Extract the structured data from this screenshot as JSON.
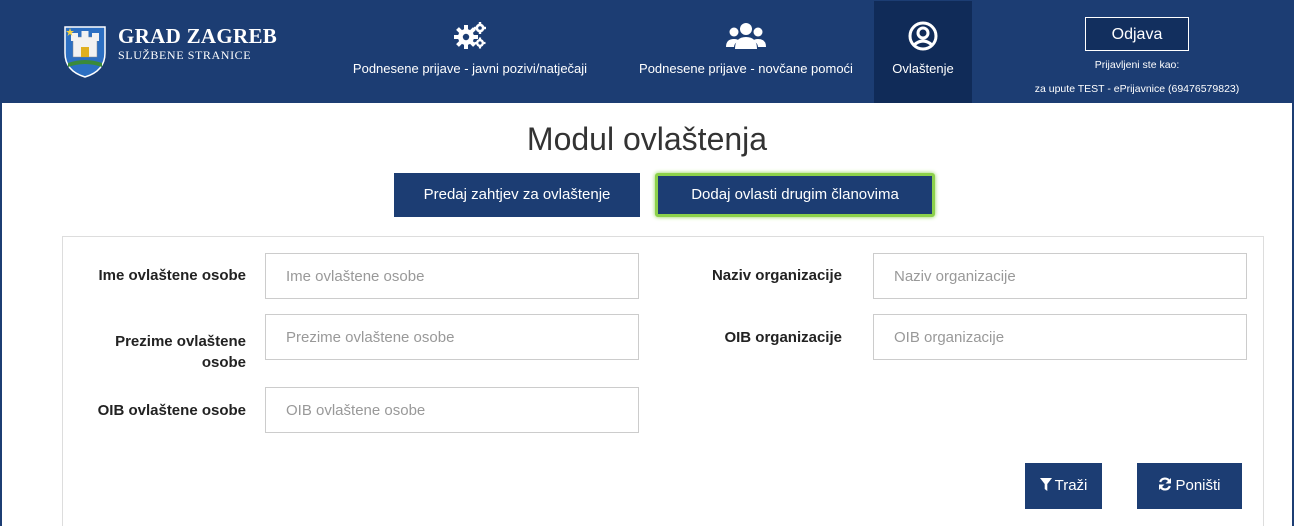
{
  "header": {
    "logo_title": "GRAD ZAGREB",
    "logo_subtitle": "SLUŽBENE STRANICE",
    "nav": [
      {
        "label": "Podnesene prijave - javni pozivi/natječaji",
        "icon": "gears-icon"
      },
      {
        "label": "Podnesene prijave - novčane pomoći",
        "icon": "users-icon"
      },
      {
        "label": "Ovlaštenje",
        "icon": "user-circle-icon"
      }
    ],
    "logout_label": "Odjava",
    "logged_in_label": "Prijavljeni ste kao:",
    "logged_in_user": "za upute TEST - ePrijavnice (69476579823)"
  },
  "main": {
    "title": "Modul ovlaštenja",
    "tabs": [
      {
        "label": "Predaj zahtjev za ovlaštenje",
        "active": false
      },
      {
        "label": "Dodaj ovlasti drugim članovima",
        "active": true
      }
    ],
    "form": {
      "ime_label": "Ime ovlaštene osobe",
      "ime_placeholder": "Ime ovlaštene osobe",
      "prezime_label_line1": "Prezime ovlaštene",
      "prezime_label_line2": "osobe",
      "prezime_placeholder": "Prezime ovlaštene osobe",
      "oib_osoba_label": "OIB ovlaštene osobe",
      "oib_osoba_placeholder": "OIB ovlaštene osobe",
      "naziv_org_label": "Naziv organizacije",
      "naziv_org_placeholder": "Naziv organizacije",
      "oib_org_label": "OIB organizacije",
      "oib_org_placeholder": "OIB organizacije"
    },
    "search_button": "Traži",
    "reset_button": "Poništi"
  },
  "colors": {
    "primary": "#1c3d73",
    "active_nav": "#102b58",
    "active_tab_border": "#8cd14b"
  }
}
